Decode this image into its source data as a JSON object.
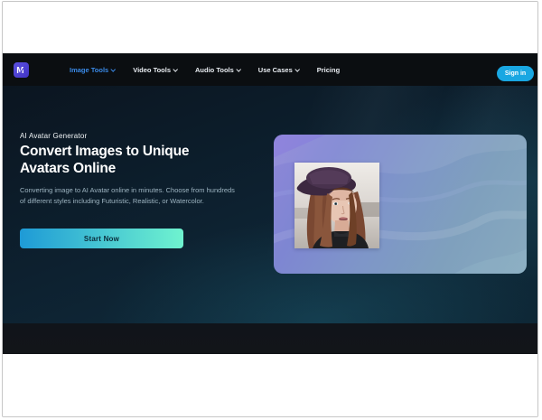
{
  "theme": {
    "active_link": "#3a8ae8",
    "signin_bg": "#19a7e2",
    "cta_from": "#1e9ad6",
    "cta_to": "#6ff3cf",
    "logo_bg": "#5b50e0",
    "nav_bg": "#0b0e11",
    "hero_bg_dark": "#0d2130",
    "card_gradient_from": "#8f87d9",
    "card_gradient_to": "#88aabf"
  },
  "icons": {
    "logo": "media-logo-m",
    "chevron": "chevron-down"
  },
  "nav": {
    "items": [
      {
        "label": "Image Tools",
        "has_dropdown": true,
        "active": true
      },
      {
        "label": "Video Tools",
        "has_dropdown": true,
        "active": false
      },
      {
        "label": "Audio Tools",
        "has_dropdown": true,
        "active": false
      },
      {
        "label": "Use Cases",
        "has_dropdown": true,
        "active": false
      },
      {
        "label": "Pricing",
        "has_dropdown": false,
        "active": false
      }
    ],
    "signin_label": "Sign in"
  },
  "hero": {
    "eyebrow": "AI Avatar Generator",
    "title_line1": "Convert Images to Unique",
    "title_line2": "Avatars Online",
    "description": "Converting image to AI Avatar online in minutes. Choose from hundreds of different styles including Futuristic, Realistic, or Watercolor.",
    "cta_label": "Start Now",
    "card_image_alt": "woman-portrait-photo"
  }
}
